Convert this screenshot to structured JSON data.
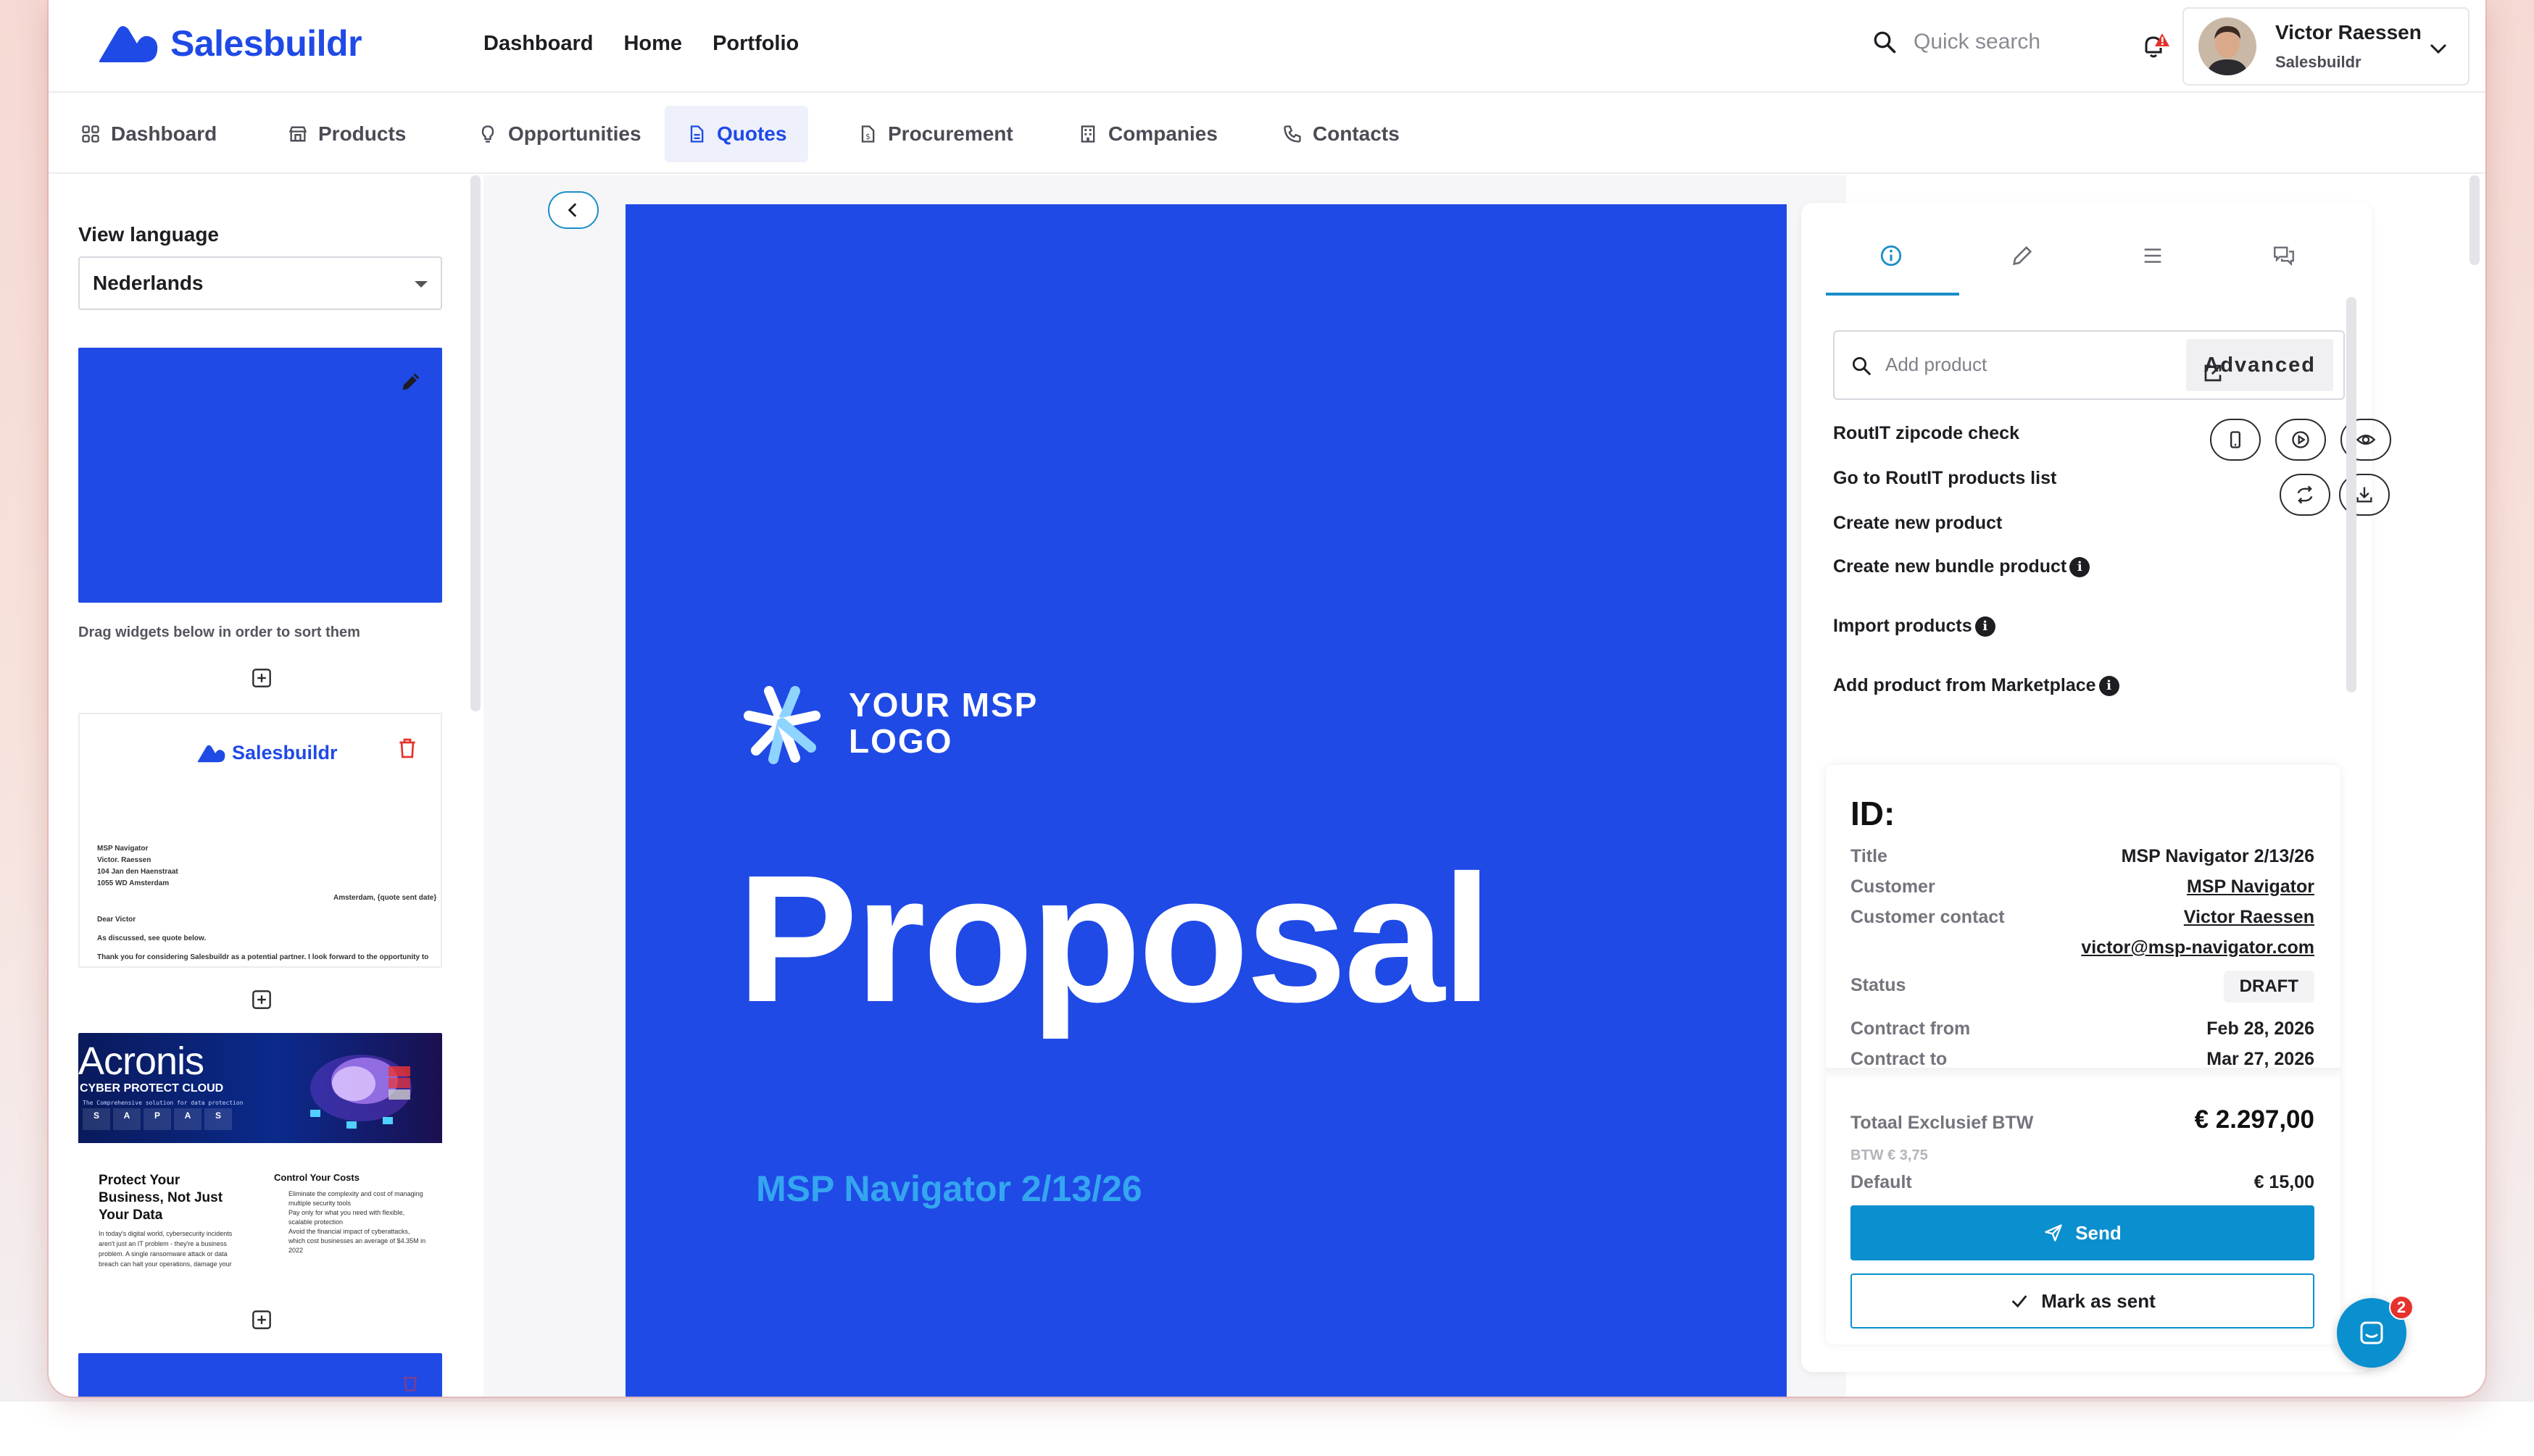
{
  "brand": {
    "name": "Salesbuildr",
    "color": "#1f4ae6",
    "accent": "#0a8fcf"
  },
  "topnav": [
    {
      "label": "Dashboard"
    },
    {
      "label": "Home"
    },
    {
      "label": "Portfolio"
    }
  ],
  "search": {
    "placeholder": "Quick search"
  },
  "user": {
    "name": "Victor Raessen",
    "org": "Salesbuildr"
  },
  "tabs": [
    {
      "label": "Dashboard",
      "icon": "dashboard-icon"
    },
    {
      "label": "Products",
      "icon": "store-icon"
    },
    {
      "label": "Opportunities",
      "icon": "lightbulb-icon"
    },
    {
      "label": "Quotes",
      "icon": "document-icon",
      "active": true
    },
    {
      "label": "Procurement",
      "icon": "clipboard-icon"
    },
    {
      "label": "Companies",
      "icon": "building-icon"
    },
    {
      "label": "Contacts",
      "icon": "phone-icon"
    }
  ],
  "left": {
    "view_language_label": "View language",
    "language": "Nederlands",
    "drag_hint": "Drag widgets below in order to sort them",
    "letter": {
      "brand": "Salesbuildr",
      "company": "MSP Navigator",
      "contact": "Victor. Raessen",
      "street": "104 Jan den Haenstraat",
      "city": "1055 WD Amsterdam",
      "place_date": "Amsterdam, {quote sent date}",
      "greeting": "Dear Victor",
      "line1": "As discussed, see quote below.",
      "line2": "Thank you for considering Salesbuildr as a potential partner. I look forward to the opportunity to"
    },
    "acronis": {
      "title": "Acronis",
      "subtitle": "CYBER PROTECT CLOUD",
      "tagline": "The Comprehensive solution for data protection",
      "pillars": [
        "S",
        "A",
        "P",
        "A",
        "S"
      ],
      "left_heading": "Protect Your Business, Not Just Your Data",
      "left_body": "In today's digital world, cybersecurity incidents aren't just an IT problem - they're a business problem. A single ransomware attack or data breach can halt your operations, damage your",
      "right_heading": "Control Your Costs",
      "right_bullets": [
        "Eliminate the complexity and cost of managing multiple security tools",
        "Pay only for what you need with flexible, scalable protection",
        "Avoid the financial impact of cyberattacks, which cost businesses an average of $4.35M in 2022"
      ]
    }
  },
  "preview": {
    "logo_line1": "YOUR MSP",
    "logo_line2": "LOGO",
    "title": "Proposal",
    "subtitle": "MSP Navigator 2/13/26"
  },
  "right": {
    "add_product_placeholder": "Add product",
    "advanced_label": "Advanced",
    "links": {
      "zipcode": "RoutIT zipcode check",
      "products_list": "Go to RoutIT products list",
      "create_product": "Create new product",
      "create_bundle": "Create new bundle product",
      "import": "Import products",
      "marketplace": "Add product from Marketplace"
    },
    "card": {
      "id_label": "ID:",
      "title_label": "Title",
      "title_value": "MSP Navigator 2/13/26",
      "customer_label": "Customer",
      "customer_value": "MSP Navigator",
      "contact_label": "Customer contact",
      "contact_value": "Victor Raessen",
      "contact_email": "victor@msp-navigator.com",
      "status_label": "Status",
      "status_value": "DRAFT",
      "from_label": "Contract from",
      "from_value": "Feb 28, 2026",
      "to_label": "Contract to",
      "to_value": "Mar 27, 2026",
      "total_label": "Totaal Exclusief BTW",
      "total_value": "€ 2.297,00",
      "btw_line": "BTW € 3,75",
      "default_label": "Default",
      "default_value": "€ 15,00",
      "send_label": "Send",
      "mark_sent_label": "Mark as sent"
    }
  },
  "chat": {
    "badge": "2"
  }
}
